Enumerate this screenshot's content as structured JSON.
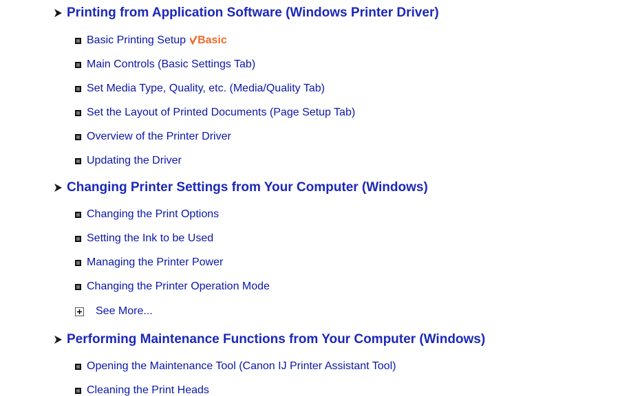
{
  "sections": [
    {
      "heading": "Printing from Application Software (Windows Printer Driver)",
      "items": [
        {
          "label": "Basic Printing Setup",
          "badge": "Basic"
        },
        {
          "label": "Main Controls (Basic Settings Tab)"
        },
        {
          "label": "Set Media Type, Quality, etc. (Media/Quality Tab)"
        },
        {
          "label": "Set the Layout of Printed Documents (Page Setup Tab)"
        },
        {
          "label": "Overview of the Printer Driver"
        },
        {
          "label": "Updating the Driver"
        }
      ]
    },
    {
      "heading": "Changing Printer Settings from Your Computer (Windows)",
      "items": [
        {
          "label": "Changing the Print Options"
        },
        {
          "label": "Setting the Ink to be Used"
        },
        {
          "label": "Managing the Printer Power"
        },
        {
          "label": "Changing the Printer Operation Mode"
        }
      ],
      "see_more": "See More..."
    },
    {
      "heading": "Performing Maintenance Functions from Your Computer (Windows)",
      "items": [
        {
          "label": "Opening the Maintenance Tool (Canon IJ Printer Assistant Tool)"
        },
        {
          "label": "Cleaning the Print Heads"
        }
      ]
    }
  ],
  "colors": {
    "heading": "#1c28b8",
    "link": "#0b17a8",
    "badge": "#f06a2a"
  },
  "icons": {
    "heading_marker": "right-arrow-icon",
    "item_marker": "square-bullet-icon",
    "expand": "plus-box-icon",
    "badge": "checkmark-icon"
  }
}
